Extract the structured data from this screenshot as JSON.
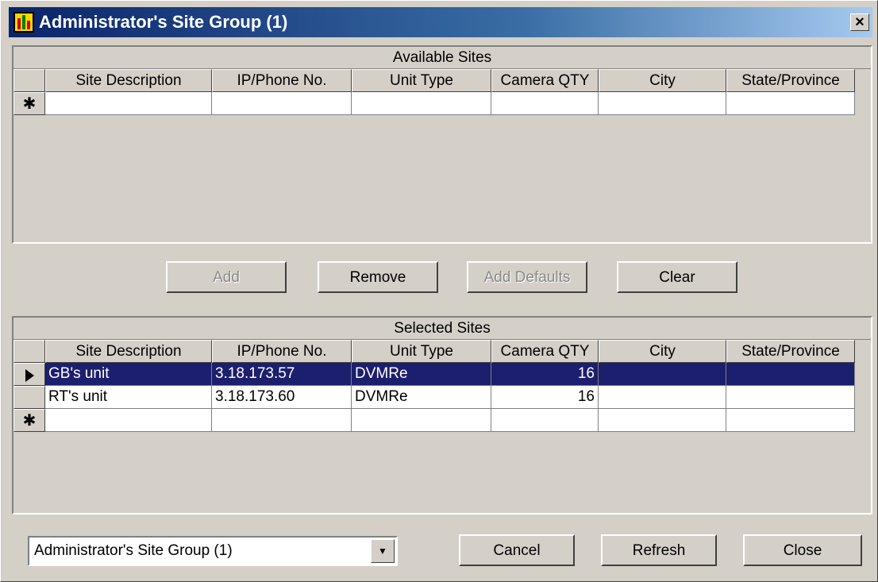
{
  "window": {
    "title": "Administrator's Site Group (1)",
    "close_glyph": "×"
  },
  "columns": [
    "Site Description",
    "IP/Phone No.",
    "Unit Type",
    "Camera QTY",
    "City",
    "State/Province"
  ],
  "available": {
    "caption": "Available Sites",
    "rows": [],
    "new_row_marker": "✱"
  },
  "buttons": {
    "add": "Add",
    "remove": "Remove",
    "add_defaults": "Add Defaults",
    "clear": "Clear",
    "cancel": "Cancel",
    "refresh": "Refresh",
    "close": "Close"
  },
  "selected": {
    "caption": "Selected Sites",
    "rows": [
      {
        "description": "GB's unit",
        "ip": "3.18.173.57",
        "unit_type": "DVMRe",
        "camera_qty": "16",
        "city": "",
        "state": "",
        "selected": true
      },
      {
        "description": "RT's unit",
        "ip": "3.18.173.60",
        "unit_type": "DVMRe",
        "camera_qty": "16",
        "city": "",
        "state": "",
        "selected": false
      }
    ],
    "new_row_marker": "✱"
  },
  "group_select": {
    "value": "Administrator's Site Group (1)"
  },
  "colors": {
    "selected_row": "#1c1e6e",
    "title_bar": "#0a246a"
  }
}
